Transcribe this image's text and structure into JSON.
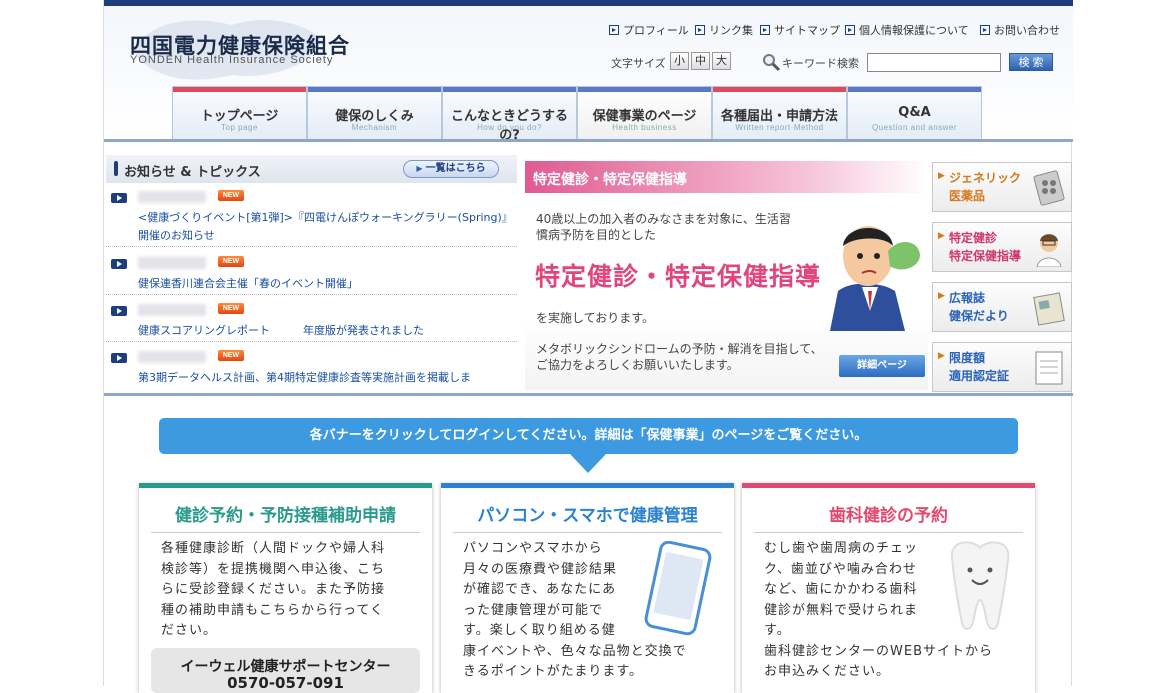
{
  "header": {
    "logo_jp": "四国電力健康保険組合",
    "logo_en": "YONDEN Health Insurance Society",
    "util_links": [
      "プロフィール",
      "リンク集",
      "サイトマップ",
      "個人情報保護について",
      "お問い合わせ"
    ],
    "font_size_label": "文字サイズ",
    "font_sizes": [
      "小",
      "中",
      "大"
    ],
    "keyword_label": "キーワード検索",
    "search_placeholder": "",
    "search_button": "検 索"
  },
  "nav": [
    {
      "jp": "トップページ",
      "en": "Top page",
      "color": "#e04a5a"
    },
    {
      "jp": "健保のしくみ",
      "en": "Mechanism",
      "color": "#5b77c9"
    },
    {
      "jp": "こんなときどうするの?",
      "en": "How do you do?",
      "color": "#5b77c9"
    },
    {
      "jp": "保健事業のページ",
      "en": "Health business",
      "color": "#5b77c9"
    },
    {
      "jp": "各種届出・申請方法",
      "en": "Written report·Method",
      "color": "#e04a5a"
    },
    {
      "jp": "Q&A",
      "en": "Question and answer",
      "color": "#5b77c9"
    }
  ],
  "news": {
    "title": "お知らせ & トピックス",
    "list_button": "一覧はこちら",
    "new_badge": "NEW",
    "items": [
      {
        "text": "<健康づくりイベント[第1弾]>『四電けんぽウォーキングラリー(Spring)』開催のお知らせ"
      },
      {
        "text": "健保連香川連合会主催「春のイベント開催」"
      },
      {
        "text": "健康スコアリングレポート　　　年度版が発表されました"
      },
      {
        "text": "第3期データヘルス計画、第4期特定健康診査等実施計画を掲載しま"
      }
    ]
  },
  "feature": {
    "head": "特定健診・特定保健指導",
    "line1": "40歳以上の加入者のみなさまを対象に、生活習慣病予防を目的とした",
    "big": "特定健診・特定保健指導",
    "line2": "を実施しております。",
    "line3": "メタボリックシンドロームの予防・解消を目指して、ご協力をよろしくお願いいたします。",
    "detail_button": "詳細ページ"
  },
  "side_banners": [
    {
      "l1": "ジェネリック",
      "l2": "医薬品",
      "color": "#d6781a"
    },
    {
      "l1": "特定健診",
      "l2": "特定保健指導",
      "color": "#d0386a"
    },
    {
      "l1": "広報誌",
      "l2": "健保だより",
      "color": "#2a62b8"
    },
    {
      "l1": "限度額",
      "l2": "適用認定証",
      "color": "#2a62b8"
    }
  ],
  "notice": "各バナーをクリックしてログインしてください。詳細は「保健事業」のページをご覧ください。",
  "cards": [
    {
      "title": "健診予約・予防接種補助申請",
      "color": "#2a9a8c",
      "body": [
        "各種健康診断（人間ドックや婦人科",
        "検診等）を提携機関へ申込後、こち",
        "らに受診登録ください。また予防接",
        "種の補助申請もこちらから行ってく",
        "ださい。"
      ],
      "center_name": "イーウェル健康サポートセンター",
      "center_phone": "0570-057-091"
    },
    {
      "title": "パソコン・スマホで健康管理",
      "color": "#2a82d0",
      "body": [
        "パソコンやスマホから",
        "月々の医療費や健診結果",
        "が確認でき、あなたにあ",
        "った健康管理が可能で",
        "す。楽しく取り組める健",
        "康イベントや、色々な品物と交換で",
        "きるポイントがたまります。"
      ]
    },
    {
      "title": "歯科健診の予約",
      "color": "#e04a70",
      "body": [
        "むし歯や歯周病のチェッ",
        "ク、歯並びや噛み合わせ",
        "など、歯にかかわる歯科",
        "健診が無料で受けられま",
        "す。",
        "歯科健診センターのWEBサイトから",
        "お申込みください。"
      ]
    }
  ]
}
